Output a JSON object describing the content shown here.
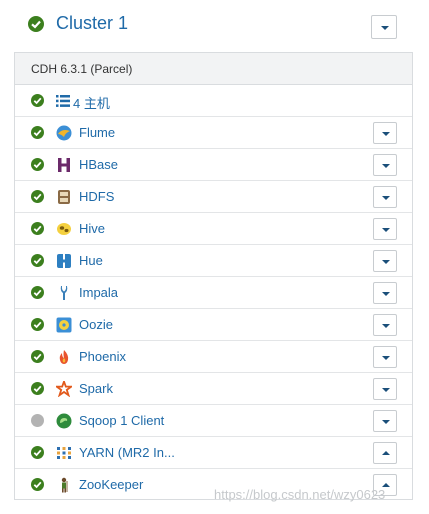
{
  "cluster": {
    "title": "Cluster 1",
    "status_icon": "check-circle-icon"
  },
  "cluster_version": "CDH 6.3.1 (Parcel)",
  "hosts": {
    "label": "4 主机",
    "icon": "list-icon"
  },
  "services": [
    {
      "name": "Flume",
      "status": "good",
      "icon": "flume-icon",
      "menu": "down"
    },
    {
      "name": "HBase",
      "status": "good",
      "icon": "hbase-icon",
      "menu": "down"
    },
    {
      "name": "HDFS",
      "status": "good",
      "icon": "hdfs-icon",
      "menu": "down"
    },
    {
      "name": "Hive",
      "status": "good",
      "icon": "hive-icon",
      "menu": "down"
    },
    {
      "name": "Hue",
      "status": "good",
      "icon": "hue-icon",
      "menu": "down"
    },
    {
      "name": "Impala",
      "status": "good",
      "icon": "impala-icon",
      "menu": "down"
    },
    {
      "name": "Oozie",
      "status": "good",
      "icon": "oozie-icon",
      "menu": "down"
    },
    {
      "name": "Phoenix",
      "status": "good",
      "icon": "phoenix-icon",
      "menu": "down"
    },
    {
      "name": "Spark",
      "status": "good",
      "icon": "spark-icon",
      "menu": "down"
    },
    {
      "name": "Sqoop 1 Client",
      "status": "none",
      "icon": "sqoop-icon",
      "menu": "down"
    },
    {
      "name": "YARN (MR2 In...",
      "status": "good",
      "icon": "yarn-icon",
      "menu": "up"
    },
    {
      "name": "ZooKeeper",
      "status": "good",
      "icon": "zookeeper-icon",
      "menu": "up"
    }
  ],
  "watermark": "https://blog.csdn.net/wzy0623",
  "colors": {
    "status_good": "#3c7f1e",
    "status_none": "#b3b3b3",
    "link": "#1f6aa8"
  }
}
